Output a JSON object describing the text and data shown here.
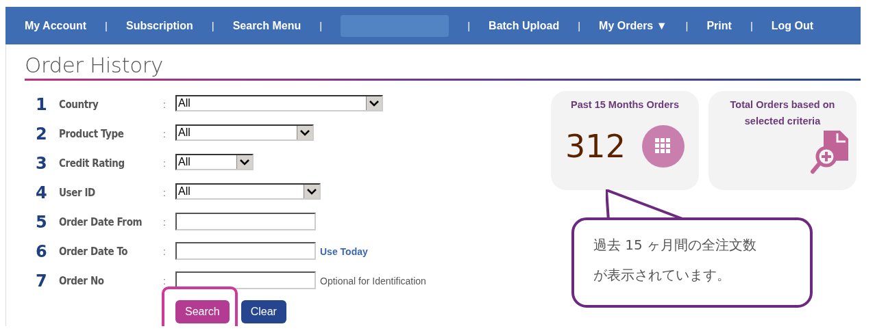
{
  "nav": {
    "items": [
      {
        "kind": "link",
        "label": "My Account"
      },
      {
        "kind": "separator",
        "label": "|"
      },
      {
        "kind": "link",
        "label": "Subscription"
      },
      {
        "kind": "separator",
        "label": "|"
      },
      {
        "kind": "link",
        "label": "Search Menu"
      },
      {
        "kind": "separator",
        "label": "|"
      },
      {
        "kind": "redacted"
      },
      {
        "kind": "separator",
        "label": "|"
      },
      {
        "kind": "link",
        "label": "Batch Upload"
      },
      {
        "kind": "separator",
        "label": "|"
      },
      {
        "kind": "link",
        "label": "My Orders ▼"
      },
      {
        "kind": "separator",
        "label": "|"
      },
      {
        "kind": "link",
        "label": "Print"
      },
      {
        "kind": "separator",
        "label": "|"
      },
      {
        "kind": "link",
        "label": "Log Out"
      }
    ]
  },
  "page_title": "Order History",
  "form": {
    "fields": [
      {
        "number": "1",
        "label": "Country",
        "colon": ":",
        "kind": "select",
        "value": "All"
      },
      {
        "number": "2",
        "label": "Product Type",
        "colon": ":",
        "kind": "select",
        "value": "All"
      },
      {
        "number": "3",
        "label": "Credit Rating",
        "colon": ":",
        "kind": "select",
        "value": "All"
      },
      {
        "number": "4",
        "label": "User ID",
        "colon": ":",
        "kind": "select",
        "value": "All"
      },
      {
        "number": "5",
        "label": "Order Date From",
        "colon": ":",
        "kind": "text"
      },
      {
        "number": "6",
        "label": "Order Date To",
        "colon": ":",
        "kind": "text",
        "link": "Use Today"
      },
      {
        "number": "7",
        "label": "Order No",
        "colon": ":",
        "kind": "text",
        "note": "Optional for Identification"
      }
    ],
    "buttons": [
      {
        "label": "Search",
        "kind": "primary",
        "highlighted": true
      },
      {
        "label": "Clear",
        "kind": "secondary",
        "highlighted": false
      }
    ]
  },
  "cards": [
    {
      "title": "Past 15 Months Orders",
      "value": "312",
      "kind": "count"
    },
    {
      "title": "Total Orders based on selected criteria",
      "kind": "search"
    }
  ],
  "callout": {
    "lines": [
      "過去 15 ヶ月間の全注文数",
      "が表示されています。"
    ]
  }
}
